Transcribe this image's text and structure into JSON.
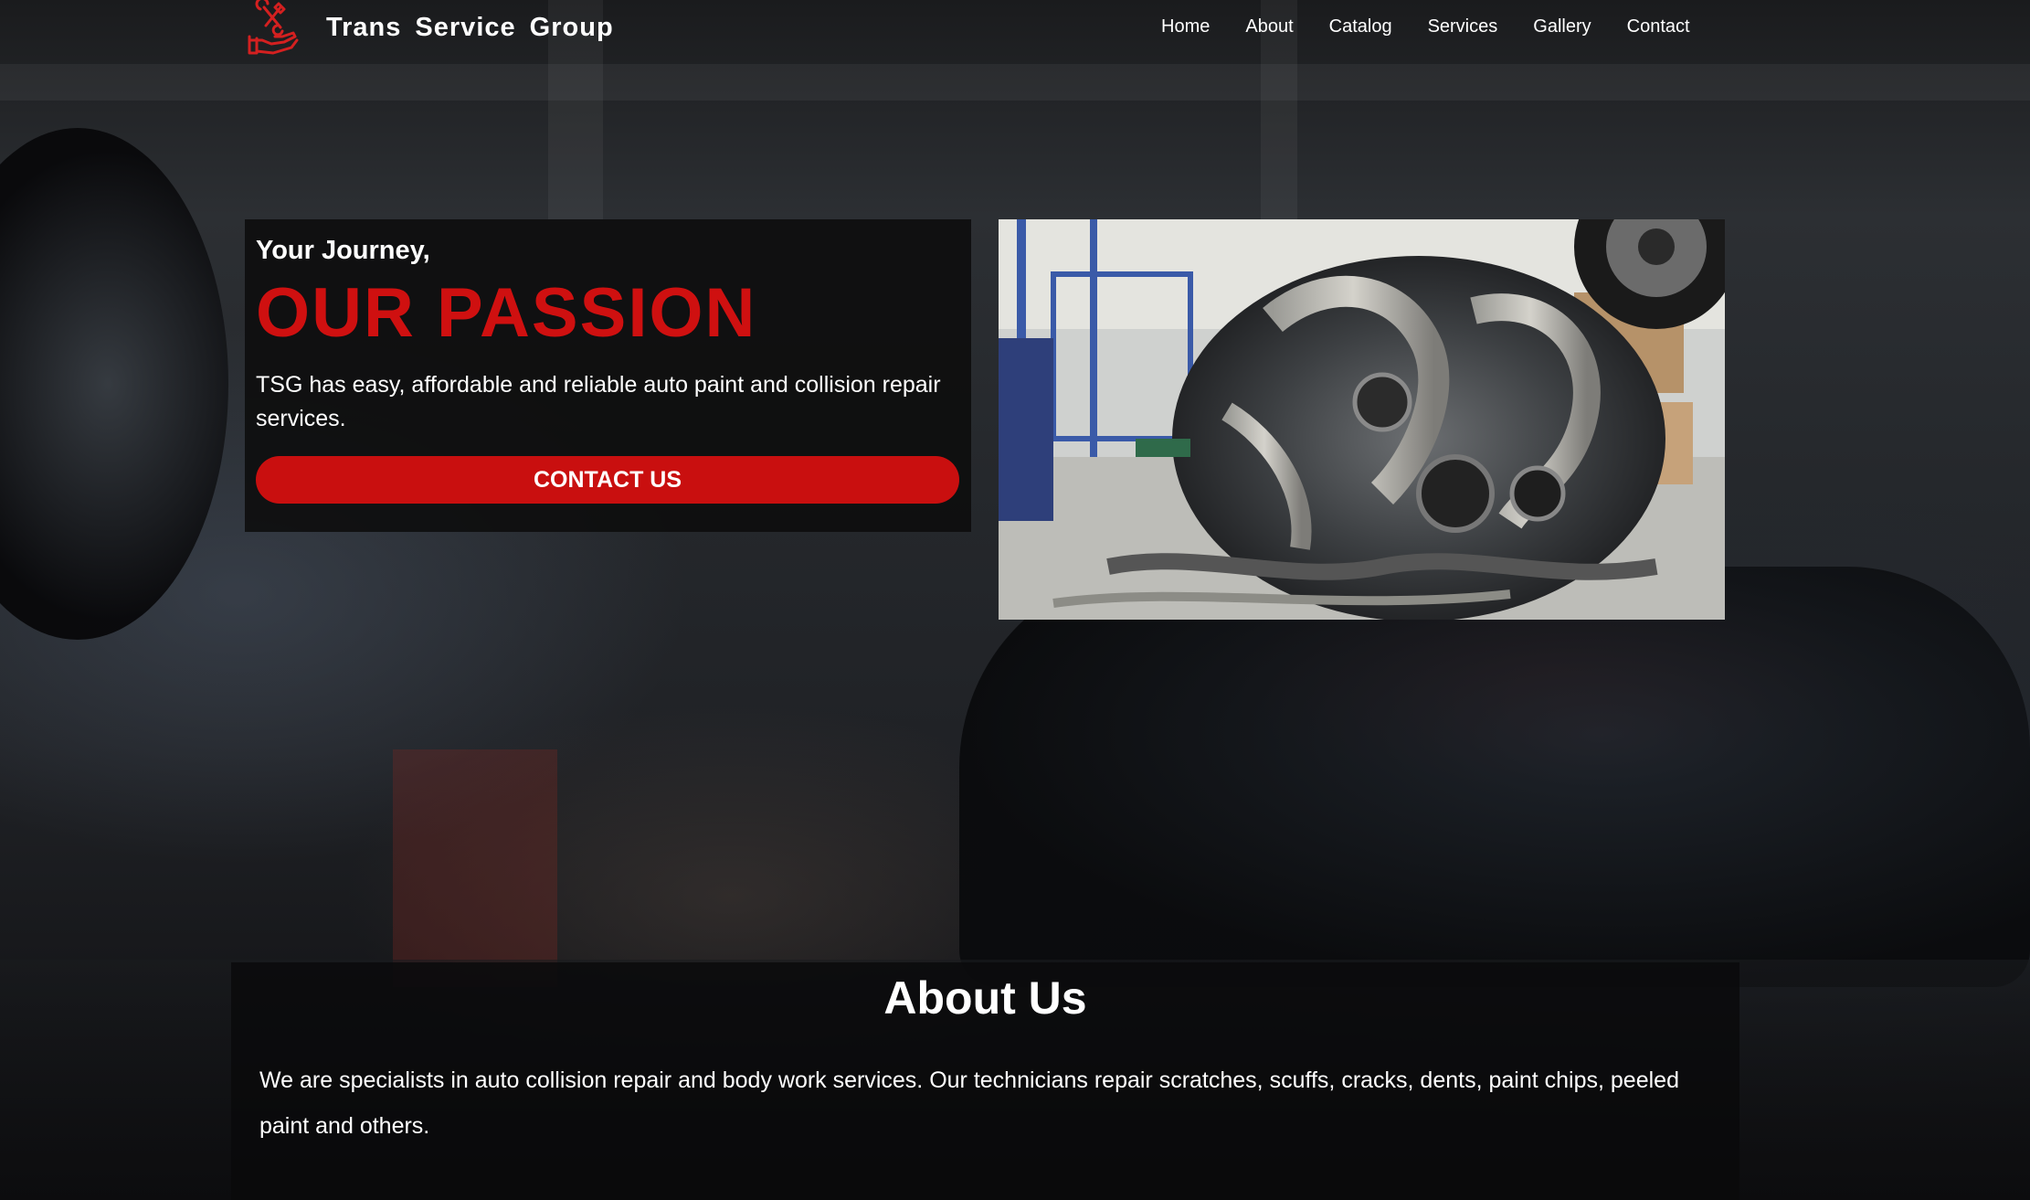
{
  "header": {
    "brand": "Trans  Service  Group",
    "logo_icon": "wrench-hand-icon",
    "nav": [
      "Home",
      "About",
      "Catalog",
      "Services",
      "Gallery",
      "Contact"
    ]
  },
  "hero": {
    "kicker": "Your Journey,",
    "title": "OUR PASSION",
    "text": "TSG has easy, affordable and reliable auto paint and collision repair services.",
    "cta_label": "CONTACT US",
    "accent_color": "#cf1010"
  },
  "about": {
    "title": "About Us",
    "text": "We are specialists in auto collision repair and body work services. Our technicians repair scratches, scuffs, cracks, dents, paint chips, peeled paint and others."
  }
}
